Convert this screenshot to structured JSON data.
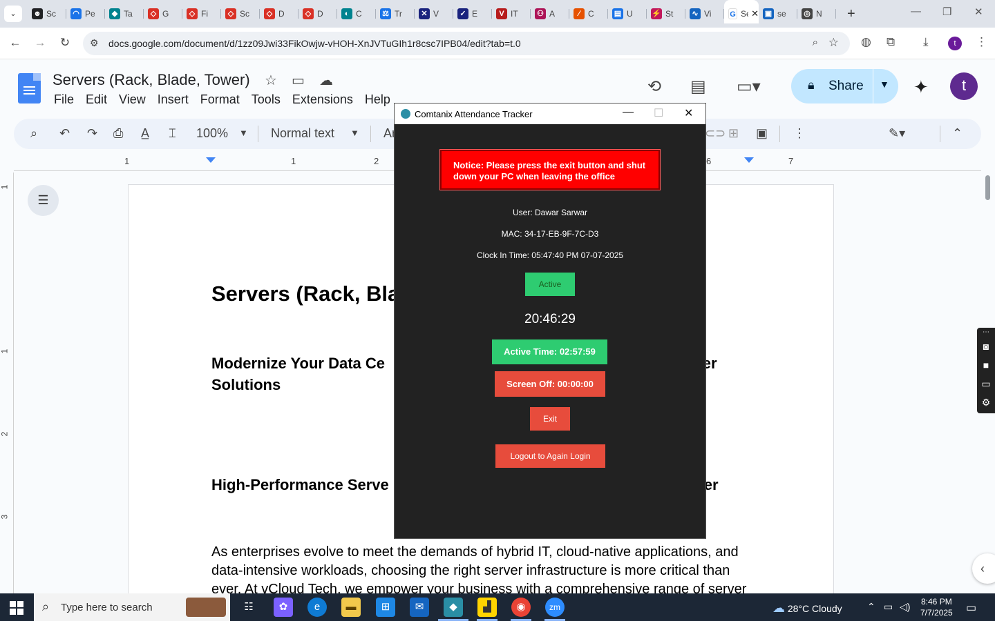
{
  "browser": {
    "tabs": [
      {
        "label": "Sc",
        "color": "#202124",
        "glyph": "☻"
      },
      {
        "label": "Pe",
        "color": "#1a73e8",
        "glyph": "◠"
      },
      {
        "label": "Ta",
        "color": "#00838f",
        "glyph": "◆"
      },
      {
        "label": "G",
        "color": "#d93025",
        "glyph": "◇"
      },
      {
        "label": "Fi",
        "color": "#d93025",
        "glyph": "◇"
      },
      {
        "label": "Sc",
        "color": "#d93025",
        "glyph": "◇"
      },
      {
        "label": "D",
        "color": "#d93025",
        "glyph": "◇"
      },
      {
        "label": "D",
        "color": "#d93025",
        "glyph": "◇"
      },
      {
        "label": "C",
        "color": "#00838f",
        "glyph": "◐"
      },
      {
        "label": "Tr",
        "color": "#1a73e8",
        "glyph": "⚖"
      },
      {
        "label": "V",
        "color": "#1a237e",
        "glyph": "✕"
      },
      {
        "label": "E",
        "color": "#1a237e",
        "glyph": "✓"
      },
      {
        "label": "IT",
        "color": "#b71c1c",
        "glyph": "V"
      },
      {
        "label": "A",
        "color": "#ad1457",
        "glyph": "⚇"
      },
      {
        "label": "C",
        "color": "#e65100",
        "glyph": "∕"
      },
      {
        "label": "U",
        "color": "#1a73e8",
        "glyph": "▤"
      },
      {
        "label": "St",
        "color": "#c2185b",
        "glyph": "⚡"
      },
      {
        "label": "Vi",
        "color": "#1565c0",
        "glyph": "∿"
      }
    ],
    "active_tab": {
      "label": "Se",
      "close": "✕"
    },
    "after_tabs": [
      {
        "label": "se",
        "color": "#1565c0",
        "glyph": "▣"
      },
      {
        "label": "N",
        "color": "#444444",
        "glyph": "◎"
      }
    ],
    "url": "docs.google.com/document/d/1zz09Jwi33FikOwjw-vHOH-XnJVTuGIh1r8csc7IPB04/edit?tab=t.0",
    "profile_initial": "t"
  },
  "docs": {
    "title": "Servers (Rack, Blade, Tower)",
    "menu": [
      "File",
      "Edit",
      "View",
      "Insert",
      "Format",
      "Tools",
      "Extensions",
      "Help"
    ],
    "share_label": "Share",
    "account_initial": "t",
    "toolbar": {
      "zoom": "100%",
      "style": "Normal text",
      "font_partial": "Ar"
    },
    "ruler_numbers": [
      "1",
      "1",
      "2",
      "6",
      "7"
    ],
    "vruler_numbers": [
      "1",
      "1",
      "2",
      "3"
    ],
    "page": {
      "heading": "Servers (Rack, Bla",
      "sub1_left": "Modernize Your Data Ce",
      "sub1_left_line2": "Solutions",
      "sub1_right": "rver",
      "sub2_left": "High-Performance Serve",
      "sub2_right": "nter",
      "paragraph": "As enterprises evolve to meet the demands of hybrid IT, cloud-native applications, and data-intensive workloads, choosing the right server infrastructure is more critical than ever. At vCloud Tech, we empower your business with a comprehensive range of server"
    }
  },
  "tracker": {
    "window_title": "Comtanix Attendance Tracker",
    "notice": "Notice: Please press the exit button and shut down your PC when leaving the office",
    "user": "User: Dawar Sarwar",
    "mac": "MAC: 34-17-EB-9F-7C-D3",
    "clock_in": "Clock In Time: 05:47:40 PM 07-07-2025",
    "status": "Active",
    "clock": "20:46:29",
    "active_time": "Active Time: 02:57:59",
    "screen_off": "Screen Off: 00:00:00",
    "exit_label": "Exit",
    "logout_label": "Logout to Again Login"
  },
  "taskbar": {
    "search_placeholder": "Type here to search",
    "weather": "28°C  Cloudy",
    "time": "8:46 PM",
    "date": "7/7/2025"
  }
}
